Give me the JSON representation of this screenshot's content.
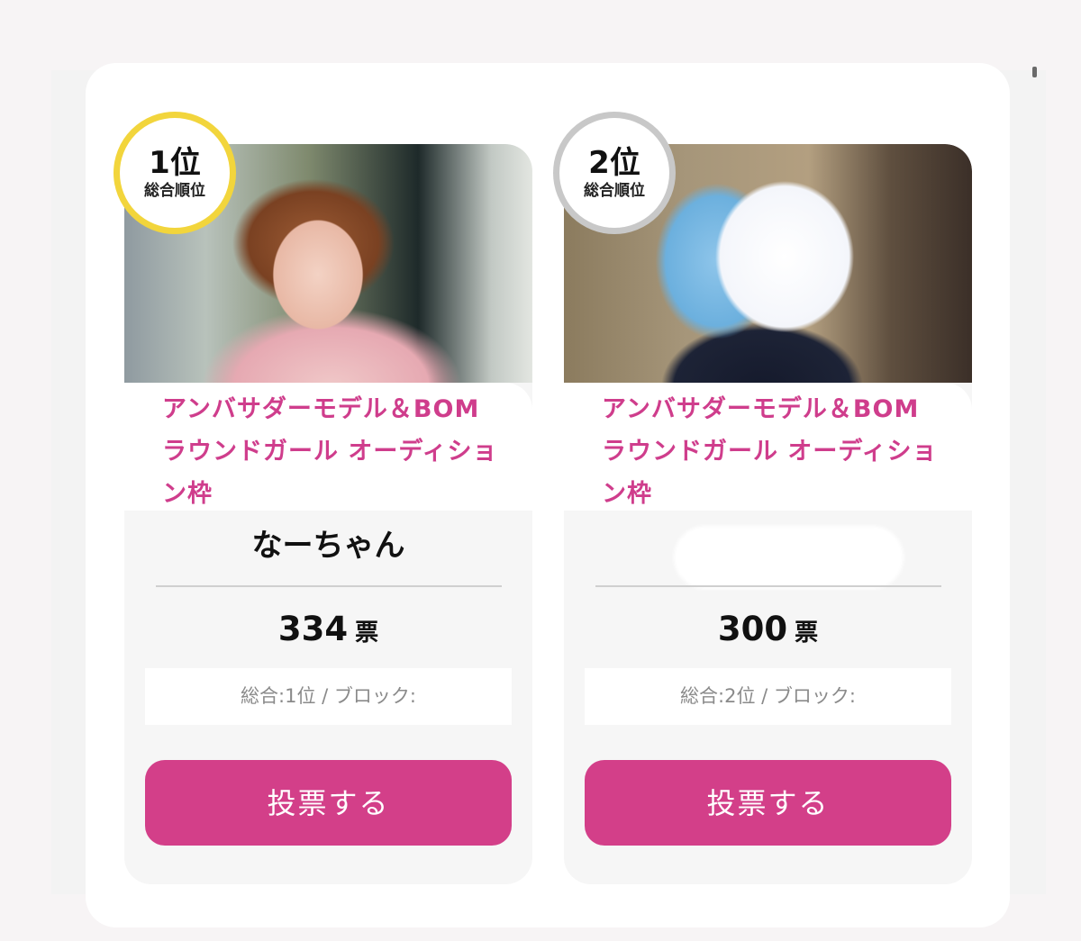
{
  "cards": [
    {
      "rank": "1位",
      "rank_sub": "総合順位",
      "title": "アンバサダーモデル＆BOMラウンドガール オーディション枠",
      "name": "なーちゃん",
      "votes": "334",
      "vote_unit": "票",
      "info": "総合:1位 / ブロック:",
      "button_label": "投票する"
    },
    {
      "rank": "2位",
      "rank_sub": "総合順位",
      "title": "アンバサダーモデル＆BOMラウンドガール オーディション枠",
      "name": "",
      "votes": "300",
      "vote_unit": "票",
      "info": "総合:2位 / ブロック:",
      "button_label": "投票する"
    }
  ],
  "colors": {
    "accent": "#d33f89",
    "title": "#cf3d8c",
    "rank1_ring": "#f2d53c",
    "rank2_ring": "#c8c8c8"
  }
}
